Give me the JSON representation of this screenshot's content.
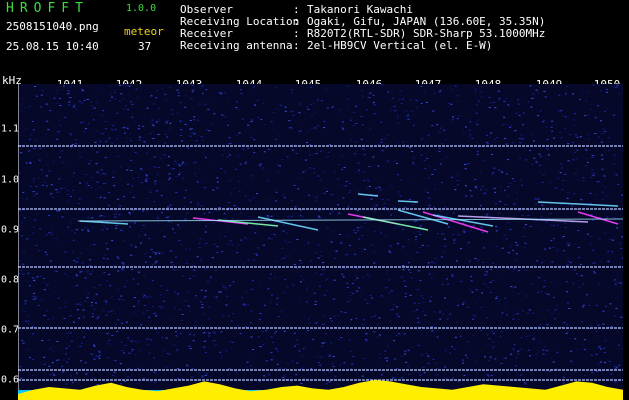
{
  "app": {
    "title": "HROFFT",
    "version": "1.0.0",
    "file_name": "2508151040.png",
    "timestamp": "25.08.15 10:40",
    "meteor_label": "meteor",
    "meteor_count": "37"
  },
  "info": [
    {
      "key": "Observer",
      "sep": ":",
      "value": "Takanori Kawachi"
    },
    {
      "key": "Receiving Location",
      "sep": ":",
      "value": "Ogaki, Gifu, JAPAN (136.60E, 35.35N)"
    },
    {
      "key": "Receiver",
      "sep": ":",
      "value": "R820T2(RTL-SDR) SDR-Sharp 53.1000MHz"
    },
    {
      "key": "Receiving antenna",
      "sep": ":",
      "value": "2el-HB9CV Vertical (el. E-W)"
    }
  ],
  "axes": {
    "x_unit": "kHz",
    "time_ticks": [
      "1041",
      "1042",
      "1043",
      "1044",
      "1045",
      "1046",
      "1047",
      "1048",
      "1049",
      "1050"
    ],
    "freq_ticks": [
      "1.1",
      "1.0",
      "0.9",
      "0.8",
      "0.7",
      "0.6"
    ]
  },
  "colors": {
    "background": "#000000",
    "noise": "#1a2a8c",
    "carrier": "#b8c8ff",
    "meteor": "#ff40ff",
    "level_fill": "#ffee00",
    "level_base": "#00c8ff",
    "title": "#3ddc3d",
    "meteor_label": "#e8d21a"
  }
}
